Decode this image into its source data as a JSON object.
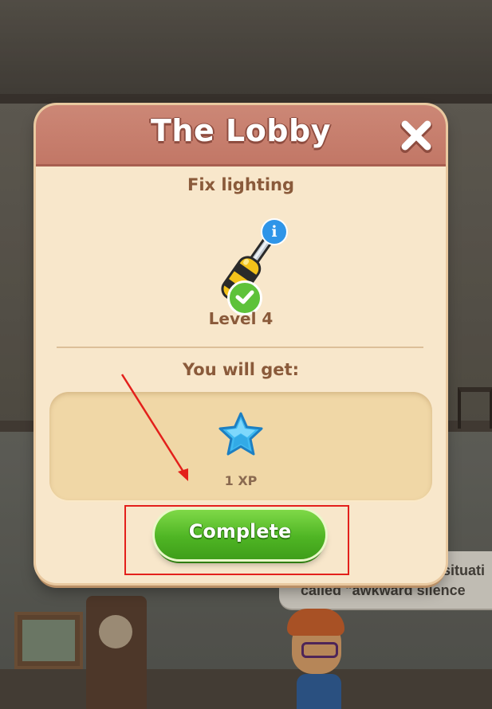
{
  "dialog": {
    "title": "The Lobby",
    "task_name": "Fix lighting",
    "level_text": "Level 4",
    "reward_title": "You will get:",
    "reward_xp": "1 XP",
    "complete_label": "Complete"
  },
  "background": {
    "speech_line1": "situati",
    "speech_line2": "called \"awkward silence"
  },
  "icons": {
    "close": "close-icon",
    "tool": "screwdriver-icon",
    "info": "info-icon",
    "check": "check-icon",
    "star": "star-icon"
  },
  "colors": {
    "header": "#c27766",
    "panel": "#f8e7cb",
    "reward_box": "#f0d7a6",
    "button_green": "#4fb524",
    "text_brown": "#8a5a3a",
    "annotation_red": "#e3201b"
  }
}
